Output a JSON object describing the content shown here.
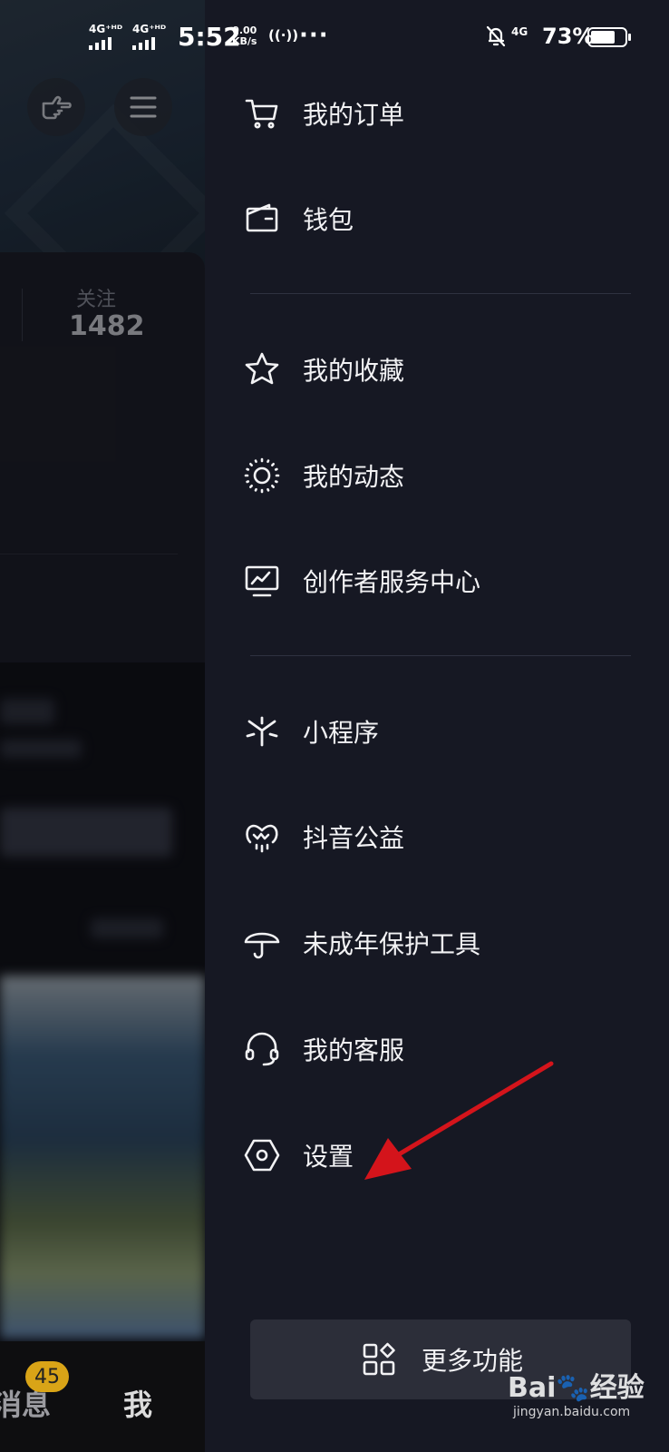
{
  "status_bar": {
    "sim1": "4G⁺ᴴᴰ",
    "sim2": "4G⁺ᴴᴰ",
    "time": "5:52",
    "speed_value": "0.00",
    "speed_unit": "KB/s",
    "hotspot": "((·))",
    "more": "···",
    "network": "4G",
    "battery_percent": "73%",
    "battery_level": 0.73
  },
  "profile_bg": {
    "follow_label": "关注",
    "follow_count": "1482",
    "tabs": {
      "messages_label": "消息",
      "messages_badge": "45",
      "me_label": "我"
    }
  },
  "drawer": {
    "group1": [
      {
        "icon": "cart-icon",
        "label": "我的订单"
      },
      {
        "icon": "wallet-icon",
        "label": "钱包"
      }
    ],
    "group2": [
      {
        "icon": "star-icon",
        "label": "我的收藏"
      },
      {
        "icon": "activity-sun-icon",
        "label": "我的动态"
      },
      {
        "icon": "creator-monitor-icon",
        "label": "创作者服务中心"
      }
    ],
    "group3": [
      {
        "icon": "mini-program-icon",
        "label": "小程序"
      },
      {
        "icon": "charity-heart-icon",
        "label": "抖音公益"
      },
      {
        "icon": "umbrella-icon",
        "label": "未成年保护工具"
      },
      {
        "icon": "headset-icon",
        "label": "我的客服"
      },
      {
        "icon": "settings-hexagon-icon",
        "label": "设置"
      }
    ],
    "more_button": {
      "icon": "grid-apps-icon",
      "label": "更多功能"
    }
  },
  "colors": {
    "background": "#161823",
    "annotation_arrow": "#d4141b",
    "badge": "#d9a417"
  },
  "watermark": {
    "brand": "Bai🐾经验",
    "url": "jingyan.baidu.com"
  }
}
